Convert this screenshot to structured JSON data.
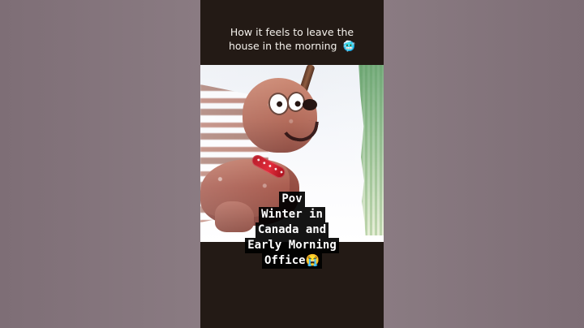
{
  "caption": {
    "line1": "How it feels to leave the",
    "line2": "house in the morning",
    "emoji": "🥶"
  },
  "overlay": {
    "lines": [
      "Pov",
      "Winter in",
      "Canada and",
      "Early Morning",
      "Office😭"
    ]
  }
}
